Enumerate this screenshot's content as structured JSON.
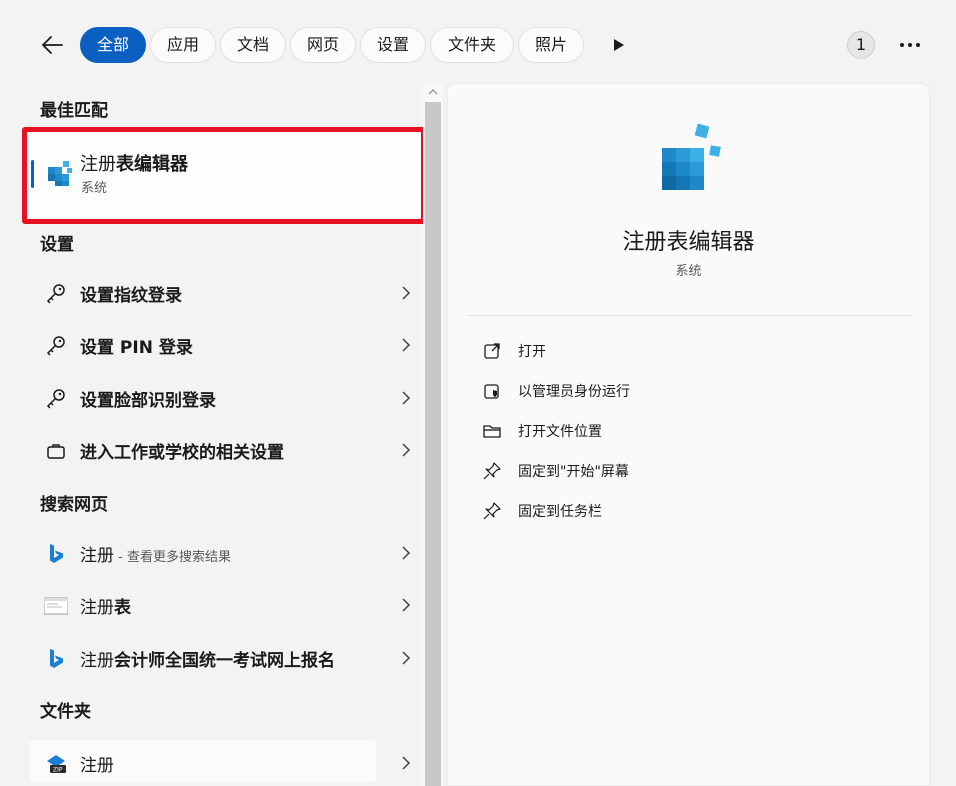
{
  "tabs": [
    "全部",
    "应用",
    "文档",
    "网页",
    "设置",
    "文件夹",
    "照片"
  ],
  "active_tab": "全部",
  "badge_count": "1",
  "sections": {
    "best_match": "最佳匹配",
    "settings": "设置",
    "web": "搜索网页",
    "folders": "文件夹"
  },
  "best": {
    "title_prefix": "注册",
    "title_bold": "表编辑器",
    "subtitle": "系统"
  },
  "settings_items": [
    "设置指纹登录",
    "设置 PIN 登录",
    "设置脸部识别登录",
    "进入工作或学校的相关设置"
  ],
  "web_items": [
    {
      "prefix": "注册",
      "hint": " - 查看更多搜索结果",
      "bold": ""
    },
    {
      "prefix": "注册",
      "hint": "",
      "bold": "表"
    },
    {
      "prefix": "注册",
      "hint": "",
      "bold": "会计师全国统一考试网上报名"
    }
  ],
  "folder_items": [
    "注册"
  ],
  "detail": {
    "title": "注册表编辑器",
    "subtitle": "系统",
    "actions": [
      "打开",
      "以管理员身份运行",
      "打开文件位置",
      "固定到\"开始\"屏幕",
      "固定到任务栏"
    ]
  },
  "colors": {
    "accent": "#0a5fc0",
    "highlight": "#e81123"
  }
}
